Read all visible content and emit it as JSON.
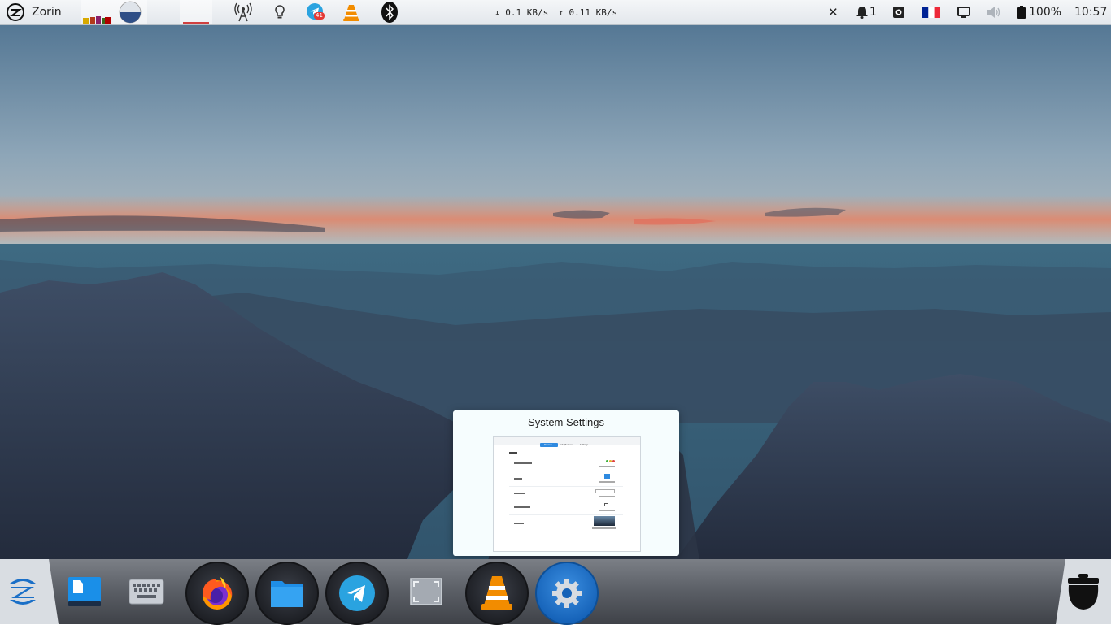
{
  "top_panel": {
    "menu_label": "Zorin",
    "network_down": "↓ 0.1 KB/s",
    "network_up": "↑ 0.11 KB/s",
    "telegram_badge": "41",
    "notifications_count": "1",
    "battery_percent": "100%",
    "clock": "10:57",
    "keyboard_layout_flag_colors": [
      "#002395",
      "#ffffff",
      "#ed2939"
    ],
    "icons": [
      "zorin-logo-icon",
      "system-monitor-icon",
      "disk-usage-icon",
      "wireless-tower-icon",
      "lightbulb-icon",
      "telegram-icon",
      "vlc-icon",
      "bluetooth-icon",
      "close-icon",
      "notification-bell-icon",
      "screenshot-icon",
      "flag-icon",
      "display-icon",
      "volume-icon",
      "battery-icon"
    ]
  },
  "preview": {
    "title": "System Settings",
    "thumbnail_tabs": [
      "Themes",
      "Add/Remove",
      "Settings"
    ]
  },
  "dock": {
    "apps": [
      {
        "name": "Zorin Menu",
        "icon": "zorin-logo-icon"
      },
      {
        "name": "Text Editor",
        "icon": "text-editor-icon"
      },
      {
        "name": "Onboard Keyboard",
        "icon": "keyboard-icon"
      },
      {
        "name": "Firefox",
        "icon": "firefox-icon"
      },
      {
        "name": "Files",
        "icon": "folder-icon"
      },
      {
        "name": "Telegram",
        "icon": "telegram-icon"
      },
      {
        "name": "Screenshot",
        "icon": "screenshot-icon"
      },
      {
        "name": "VLC",
        "icon": "vlc-icon"
      },
      {
        "name": "System Settings",
        "icon": "gear-icon"
      },
      {
        "name": "Trash",
        "icon": "trash-icon"
      }
    ]
  },
  "colors": {
    "active_accent": "#1a6fc7",
    "telegram_blue": "#2aa3e0",
    "vlc_orange": "#f28c00",
    "folder_blue": "#1f8ee6"
  }
}
